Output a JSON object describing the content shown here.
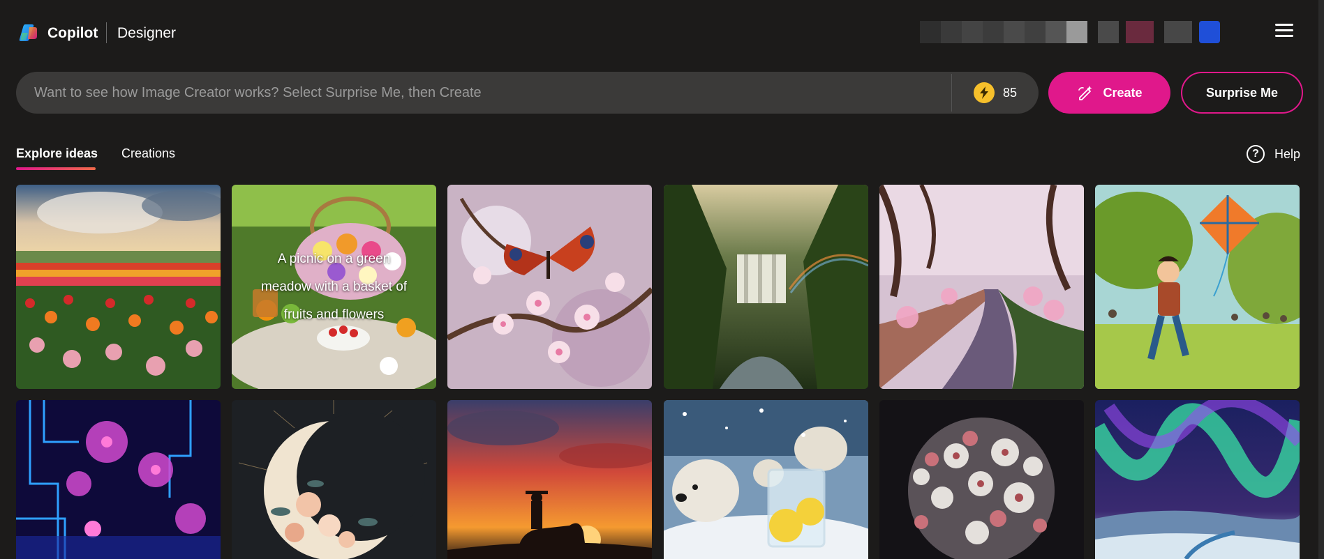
{
  "header": {
    "brand": "Copilot",
    "product": "Designer",
    "menu_icon": "hamburger-menu-icon"
  },
  "search": {
    "placeholder": "Want to see how Image Creator works? Select Surprise Me, then Create",
    "boosts": "85",
    "boost_icon": "lightning-bolt-icon"
  },
  "actions": {
    "create_label": "Create",
    "surprise_label": "Surprise Me"
  },
  "tabs": [
    {
      "label": "Explore ideas",
      "active": true
    },
    {
      "label": "Creations",
      "active": false
    }
  ],
  "help": {
    "label": "Help",
    "icon": "question-circle-icon"
  },
  "gallery": {
    "row1": [
      {
        "subject": "tulip-field",
        "caption": ""
      },
      {
        "subject": "picnic",
        "caption": "A picnic on a green meadow with a basket of fruits and flowers"
      },
      {
        "subject": "butterfly-blossoms",
        "caption": ""
      },
      {
        "subject": "jungle-waterfall",
        "caption": ""
      },
      {
        "subject": "cherry-blossom-river",
        "caption": ""
      },
      {
        "subject": "boy-with-kite",
        "caption": ""
      }
    ],
    "row2": [
      {
        "subject": "neon-circuit-garden",
        "caption": ""
      },
      {
        "subject": "floral-crescent-moon",
        "caption": ""
      },
      {
        "subject": "cowboy-sunset",
        "caption": ""
      },
      {
        "subject": "polar-bears-lemonade",
        "caption": ""
      },
      {
        "subject": "flower-sphere",
        "caption": ""
      },
      {
        "subject": "aurora-borealis",
        "caption": ""
      }
    ]
  },
  "colors": {
    "background": "#1c1b1a",
    "accent": "#e0188b",
    "search_bg": "#3b3a39",
    "boost": "#f7c02b"
  }
}
